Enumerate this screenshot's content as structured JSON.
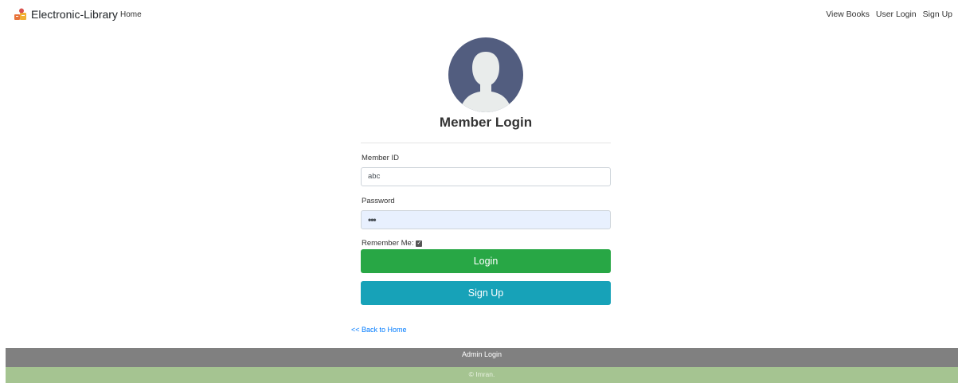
{
  "navbar": {
    "brand": "Electronic-Library",
    "home": "Home",
    "links": [
      "View Books",
      "User Login",
      "Sign Up"
    ]
  },
  "login": {
    "title": "Member Login",
    "member_id_label": "Member ID",
    "member_id_value": "abc",
    "password_label": "Password",
    "password_value": "•••",
    "remember_label": "Remember Me:",
    "remember_checked": true,
    "login_button": "Login",
    "signup_button": "Sign Up",
    "back_link": "<< Back to Home"
  },
  "footer": {
    "admin_login": "Admin Login",
    "copyright": "© Imran."
  },
  "colors": {
    "login_button": "#28a745",
    "signup_button": "#17a2b8",
    "footer_admin": "#808080",
    "footer_copy": "#a5c491",
    "avatar_bg": "#525d7f",
    "link": "#007bff"
  }
}
